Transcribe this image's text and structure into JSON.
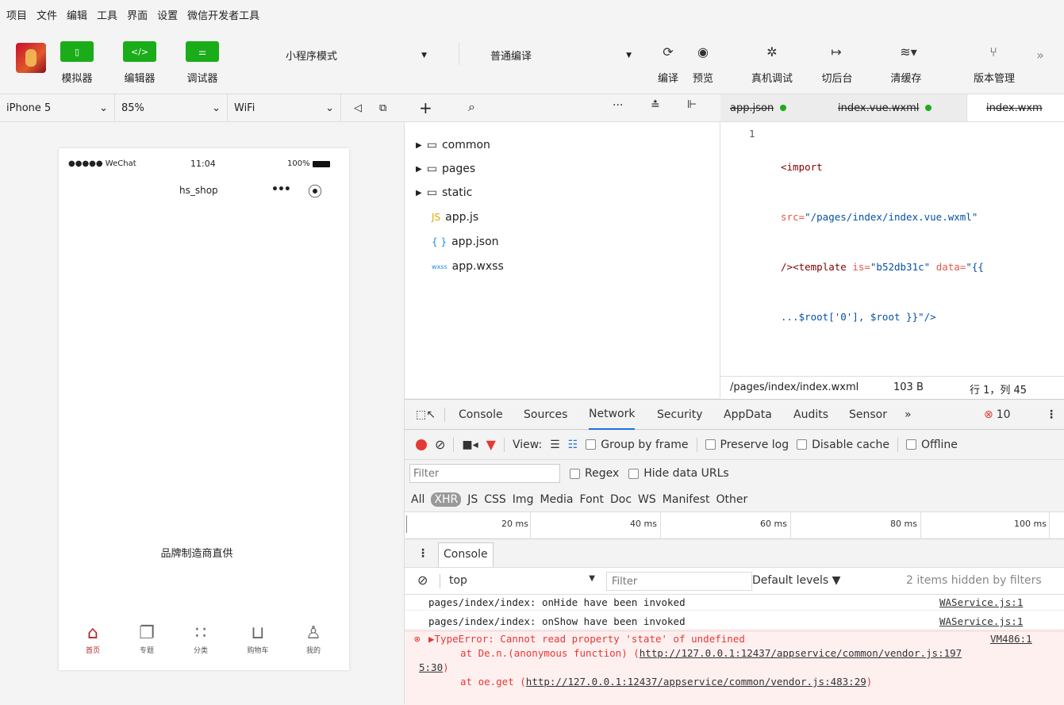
{
  "menu": [
    "项目",
    "文件",
    "编辑",
    "工具",
    "界面",
    "设置",
    "微信开发者工具"
  ],
  "toolbar": {
    "simulator": "模拟器",
    "editor": "编辑器",
    "debugger": "调试器",
    "mode": "小程序模式",
    "compile_mode": "普通编译",
    "compile": "编译",
    "preview": "预览",
    "remote_debug": "真机调试",
    "background": "切后台",
    "clear_cache": "清缓存",
    "version": "版本管理",
    "more": "»"
  },
  "device": {
    "model": "iPhone 5",
    "zoom": "85%",
    "network": "WiFi"
  },
  "phone": {
    "signal": "●●●●● WeChat",
    "time": "11:04",
    "battery": "100%",
    "title": "hs_shop",
    "content": "品牌制造商直供",
    "tabs": [
      "首页",
      "专题",
      "分类",
      "购物车",
      "我的"
    ]
  },
  "tree": {
    "items": [
      {
        "icon": "folder",
        "name": "common"
      },
      {
        "icon": "folder",
        "name": "pages"
      },
      {
        "icon": "folder",
        "name": "static"
      },
      {
        "icon": "JS",
        "name": "app.js"
      },
      {
        "icon": "{ }",
        "name": "app.json"
      },
      {
        "icon": "wxss",
        "name": "app.wxss"
      }
    ]
  },
  "editor": {
    "tabs": [
      "app.json",
      "index.vue.wxml",
      "index.wxm"
    ],
    "line_no": "1",
    "code": {
      "l1_tag": "<import",
      "l2_attr": "src=",
      "l2_val": "\"/pages/index/index.vue.wxml\"",
      "l3_end": "/>",
      "l3_tag": "<template",
      "l3_attr1": " is=",
      "l3_val1": "\"b52db31c\"",
      "l3_attr2": " data=",
      "l3_val2": "\"{{",
      "l4": "...$root['0'], $root }}\"/>"
    },
    "path": "/pages/index/index.wxml",
    "size": "103 B",
    "position": "行 1，列 45"
  },
  "devtools": {
    "tabs": [
      "Console",
      "Sources",
      "Network",
      "Security",
      "AppData",
      "Audits",
      "Sensor",
      "»"
    ],
    "error_count": "10",
    "view_label": "View:",
    "group_by_frame": "Group by frame",
    "preserve_log": "Preserve log",
    "disable_cache": "Disable cache",
    "offline": "Offline",
    "filter_placeholder": "Filter",
    "regex": "Regex",
    "hide_data_urls": "Hide data URLs",
    "types": [
      "All",
      "XHR",
      "JS",
      "CSS",
      "Img",
      "Media",
      "Font",
      "Doc",
      "WS",
      "Manifest",
      "Other"
    ],
    "timeline": [
      "20 ms",
      "40 ms",
      "60 ms",
      "80 ms",
      "100 ms"
    ],
    "console_tab": "Console",
    "context": "top",
    "console_filter": "Filter",
    "levels": "Default levels ▼",
    "hidden": "2 items hidden by filters",
    "logs": [
      {
        "text": "pages/index/index: onHide have been invoked",
        "src": "WAService.js:1"
      },
      {
        "text": "pages/index/index: onShow have been invoked",
        "src": "WAService.js:1"
      }
    ],
    "error": {
      "title": "▶TypeError: Cannot read property 'state' of undefined",
      "src": "VM486:1",
      "line1_pre": "at De.n.(anonymous function) (",
      "line1_link": "http://127.0.0.1:12437/appservice/common/vendor.js:197",
      "line1_cont": "5:30",
      "line2_pre": "at oe.get (",
      "line2_link": "http://127.0.0.1:12437/appservice/common/vendor.js:483:29"
    }
  }
}
